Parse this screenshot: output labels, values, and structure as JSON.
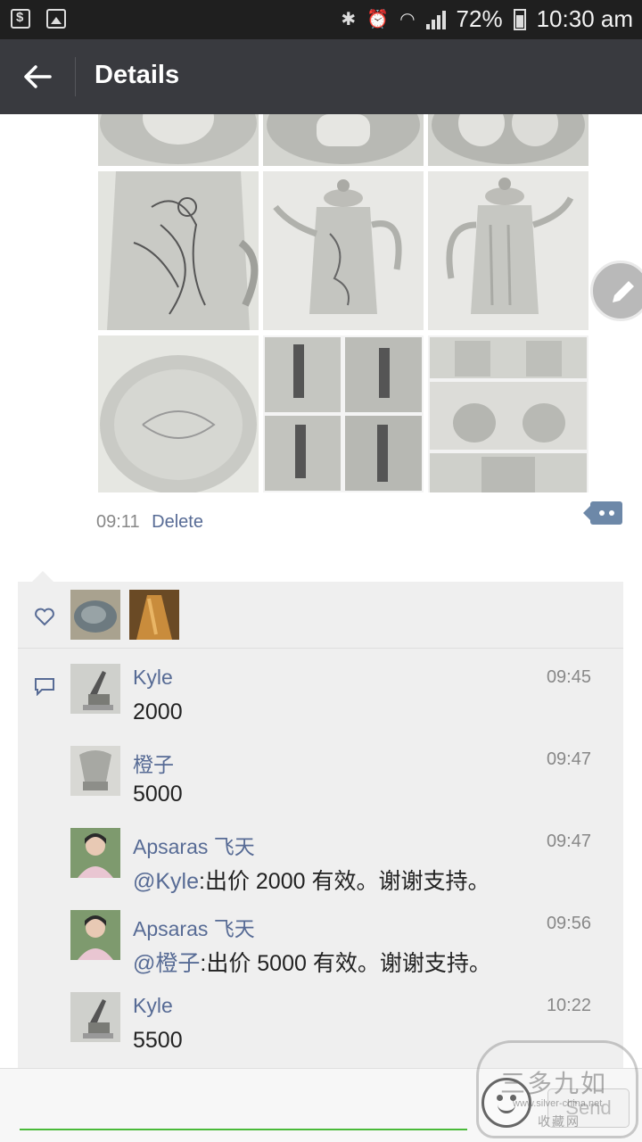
{
  "status_bar": {
    "battery": "72%",
    "time": "10:30 am",
    "icons": [
      "money-icon",
      "image-icon",
      "bluetooth-icon",
      "alarm-icon",
      "wifi-icon",
      "signal-icon",
      "battery-icon"
    ]
  },
  "app_bar": {
    "title": "Details",
    "back_icon": "arrow-left-icon"
  },
  "post": {
    "time": "09:11",
    "delete_label": "Delete",
    "images": [
      "silver-tray-top-left",
      "silver-pot-top-middle",
      "silver-pot-top-right",
      "engraved-pot-closeup",
      "engraved-coffee-pot",
      "coffee-pot-side",
      "engraved-tray",
      "hallmarks-collage",
      "tea-set-collage"
    ],
    "edit_icon": "pencil-icon",
    "more_icon": "more-dots-icon"
  },
  "likes": {
    "icon": "heart-icon",
    "avatars": [
      "liker-avatar-1",
      "liker-avatar-2"
    ]
  },
  "comments": {
    "icon": "comment-icon",
    "items": [
      {
        "name": "Kyle",
        "time": "09:45",
        "text": "2000"
      },
      {
        "name": "橙子",
        "time": "09:47",
        "text": "5000"
      },
      {
        "name": "Apsaras 飞天",
        "time": "09:47",
        "mention": "@Kyle",
        "text": ":出价 2000 有效。谢谢支持。"
      },
      {
        "name": "Apsaras 飞天",
        "time": "09:56",
        "mention": "@橙子",
        "text": ":出价 5000 有效。谢谢支持。"
      },
      {
        "name": "Kyle",
        "time": "10:22",
        "text": "5500"
      }
    ]
  },
  "input_bar": {
    "emoji_icon": "emoji-icon",
    "send_label": "Send"
  },
  "watermark": {
    "main": "三多九如",
    "url": "www.silver-china.net",
    "sub": "收藏网"
  },
  "colors": {
    "app_bar": "#393a3f",
    "link": "#576b95",
    "input_underline": "#4aba3a"
  }
}
